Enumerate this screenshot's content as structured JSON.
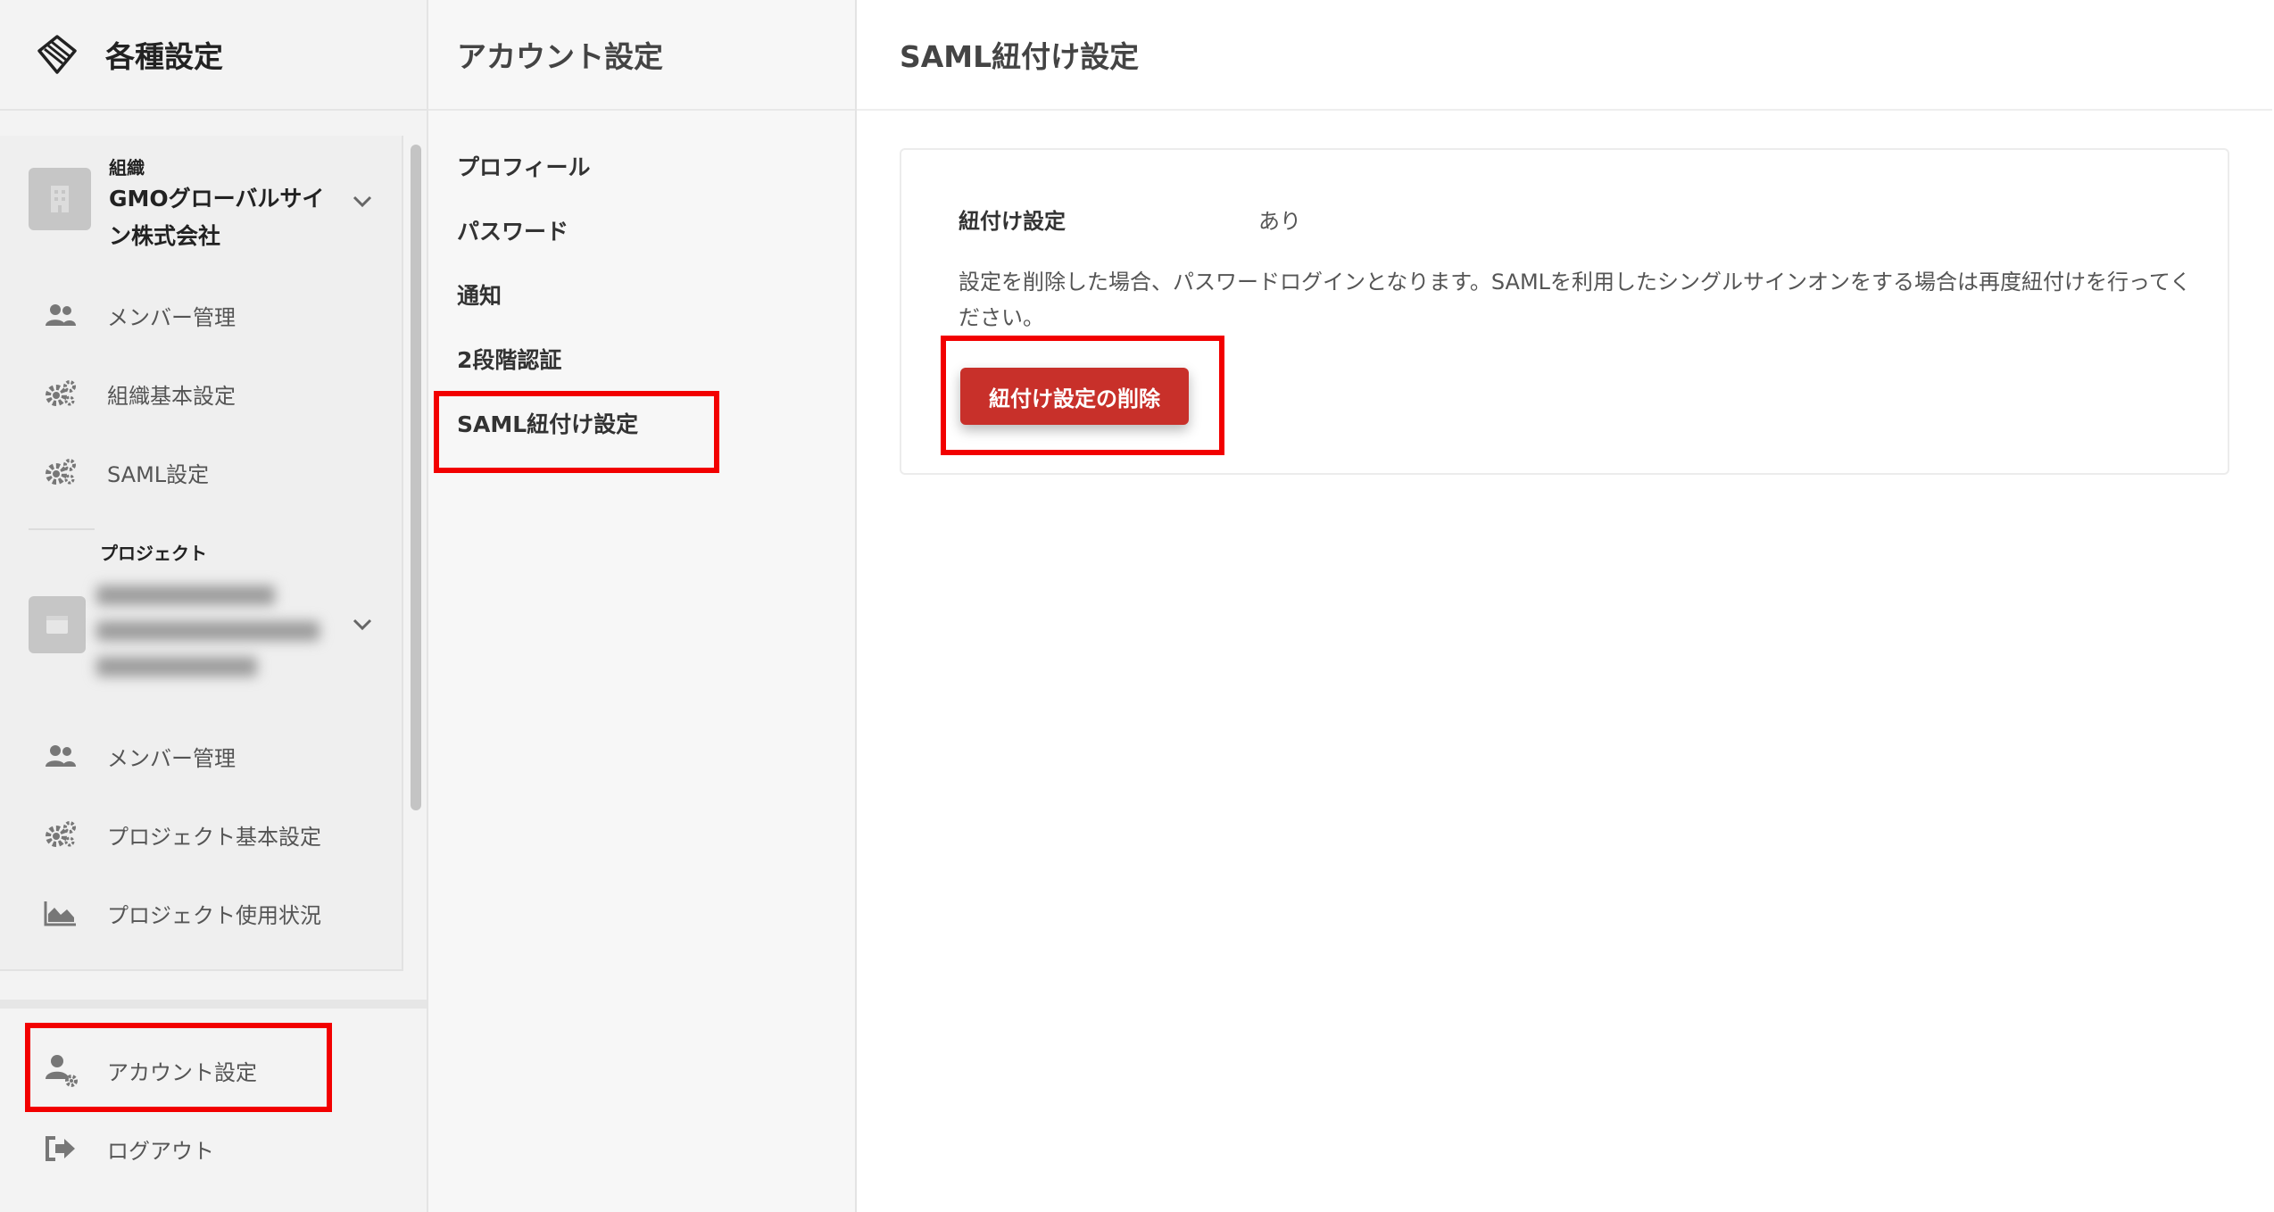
{
  "sidebar": {
    "title": "各種設定",
    "organization": {
      "label": "組織",
      "name": "GMOグローバルサイン株式会社",
      "items": [
        {
          "label": "メンバー管理",
          "icon": "users-icon"
        },
        {
          "label": "組織基本設定",
          "icon": "gears-icon"
        },
        {
          "label": "SAML設定",
          "icon": "gears-icon"
        }
      ]
    },
    "project": {
      "label": "プロジェクト",
      "items": [
        {
          "label": "メンバー管理",
          "icon": "users-icon"
        },
        {
          "label": "プロジェクト基本設定",
          "icon": "gears-icon"
        },
        {
          "label": "プロジェクト使用状況",
          "icon": "area-chart-icon"
        }
      ]
    },
    "bottom": {
      "account_label": "アカウント設定",
      "logout_label": "ログアウト"
    }
  },
  "middle": {
    "title": "アカウント設定",
    "menu": [
      {
        "label": "プロフィール"
      },
      {
        "label": "パスワード"
      },
      {
        "label": "通知"
      },
      {
        "label": "2段階認証"
      },
      {
        "label": "SAML紐付け設定"
      }
    ]
  },
  "content": {
    "title": "SAML紐付け設定",
    "field_label": "紐付け設定",
    "field_value": "あり",
    "description": "設定を削除した場合、パスワードログインとなります。SAMLを利用したシングルサインオンをする場合は再度紐付けを行ってください。",
    "delete_button": "紐付け設定の削除"
  },
  "colors": {
    "accent_red": "#c8302a",
    "highlight": "#f20000"
  }
}
